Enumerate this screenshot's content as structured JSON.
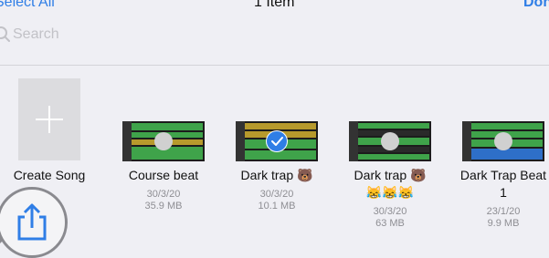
{
  "header": {
    "select_all": "Select All",
    "title": "1 Item",
    "done": "Done"
  },
  "search": {
    "placeholder": "Search"
  },
  "create": {
    "label": "Create Song",
    "icon": "plus-icon"
  },
  "songs": [
    {
      "title": "Course beat",
      "date": "30/3/20",
      "size": "35.9 MB",
      "selected": false
    },
    {
      "title": "Dark trap 🐻",
      "date": "30/3/20",
      "size": "10.1 MB",
      "selected": true
    },
    {
      "title": "Dark trap 🐻",
      "title_line2": "😹😹😹",
      "date": "30/3/20",
      "size": "63 MB",
      "selected": false
    },
    {
      "title": "Dark Trap Beat",
      "title_line2": "1",
      "date": "23/1/20",
      "size": "9.9 MB",
      "selected": false
    }
  ],
  "share": {
    "icon": "share-icon"
  },
  "colors": {
    "accent": "#2f7ee6",
    "background": "#efeff4",
    "track_yellow": "#b79a2c",
    "track_green": "#3fa34a",
    "track_blue": "#2e6fc8"
  }
}
